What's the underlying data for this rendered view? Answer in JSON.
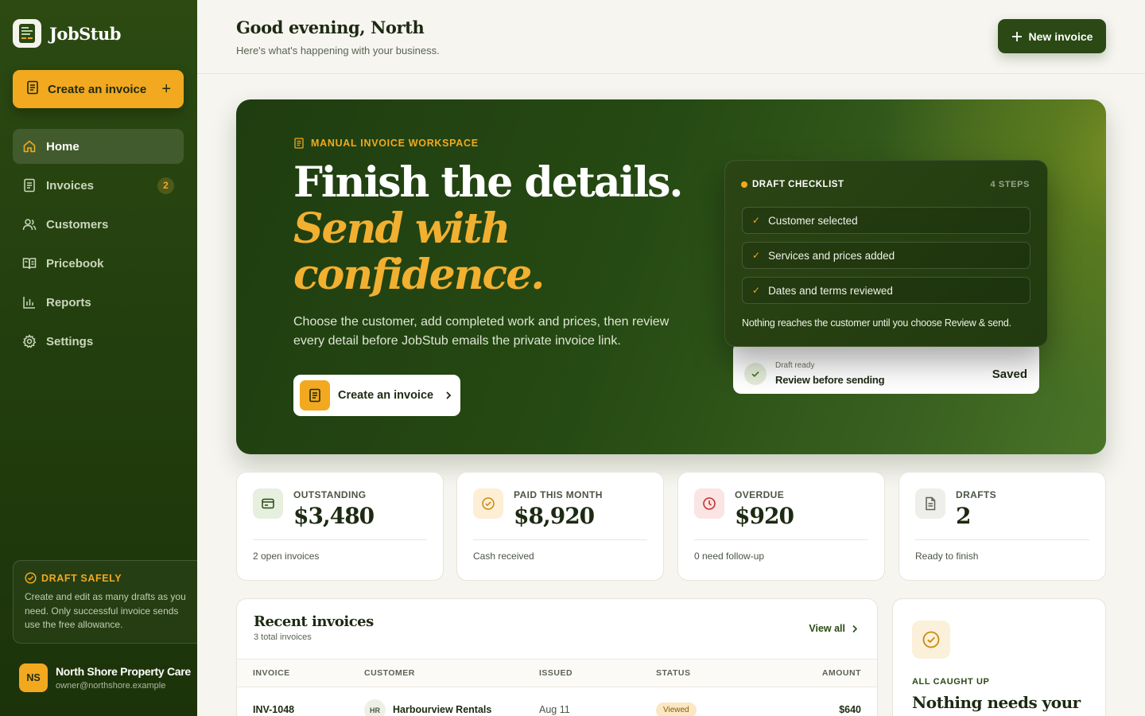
{
  "brand": {
    "name": "JobStub"
  },
  "sidebar": {
    "create_label": "Create an invoice",
    "items": [
      {
        "label": "Home",
        "icon": "home-icon",
        "active": true
      },
      {
        "label": "Invoices",
        "icon": "document-icon",
        "badge": "2"
      },
      {
        "label": "Customers",
        "icon": "users-icon"
      },
      {
        "label": "Pricebook",
        "icon": "book-icon"
      },
      {
        "label": "Reports",
        "icon": "chart-icon"
      },
      {
        "label": "Settings",
        "icon": "gear-icon"
      }
    ],
    "draft_safe": {
      "title": "DRAFT SAFELY",
      "text": "Create and edit as many drafts as you need. Only successful invoice sends use the free allowance."
    },
    "account": {
      "initials": "NS",
      "name": "North Shore Property Care",
      "email": "owner@northshore.example"
    }
  },
  "header": {
    "greeting": "Good evening, North",
    "subtitle": "Here's what's happening with your business.",
    "new_invoice_label": "New invoice"
  },
  "hero": {
    "eyebrow": "MANUAL INVOICE WORKSPACE",
    "headline": "Finish the details.",
    "headline_accent": "Send with confidence.",
    "description": "Choose the customer, add completed work and prices, then review every detail before JobStub emails the private invoice link.",
    "cta_label": "Create an invoice",
    "checklist": {
      "title": "DRAFT CHECKLIST",
      "steps_label": "4 STEPS",
      "items": [
        "Customer selected",
        "Services and prices added",
        "Dates and terms reviewed"
      ],
      "footer": "Nothing reaches the customer until you choose Review & send."
    },
    "saved_card": {
      "small": "Draft ready",
      "main": "Review before sending",
      "status": "Saved"
    }
  },
  "stats": [
    {
      "label": "OUTSTANDING",
      "value": "$3,480",
      "note": "2 open invoices",
      "icon": "wallet-icon",
      "color": "#e7efdf"
    },
    {
      "label": "PAID THIS MONTH",
      "value": "$8,920",
      "note": "Cash received",
      "icon": "check-circle-icon",
      "color": "#fcefd6"
    },
    {
      "label": "OVERDUE",
      "value": "$920",
      "note": "0 need follow-up",
      "icon": "clock-icon",
      "color": "#fbe4e4"
    },
    {
      "label": "DRAFTS",
      "value": "2",
      "note": "Ready to finish",
      "icon": "file-icon",
      "color": "#eeeeea"
    }
  ],
  "recent": {
    "title": "Recent invoices",
    "subtitle": "3 total invoices",
    "view_all": "View all",
    "columns": [
      "INVOICE",
      "CUSTOMER",
      "ISSUED",
      "STATUS",
      "AMOUNT"
    ],
    "rows": [
      {
        "invoice": "INV-1048",
        "initials": "HR",
        "customer": "Harbourview Rentals",
        "issued": "Aug 11",
        "status": "Viewed",
        "amount": "$640"
      }
    ]
  },
  "caught_up": {
    "label": "ALL CAUGHT UP",
    "title": "Nothing needs your"
  }
}
